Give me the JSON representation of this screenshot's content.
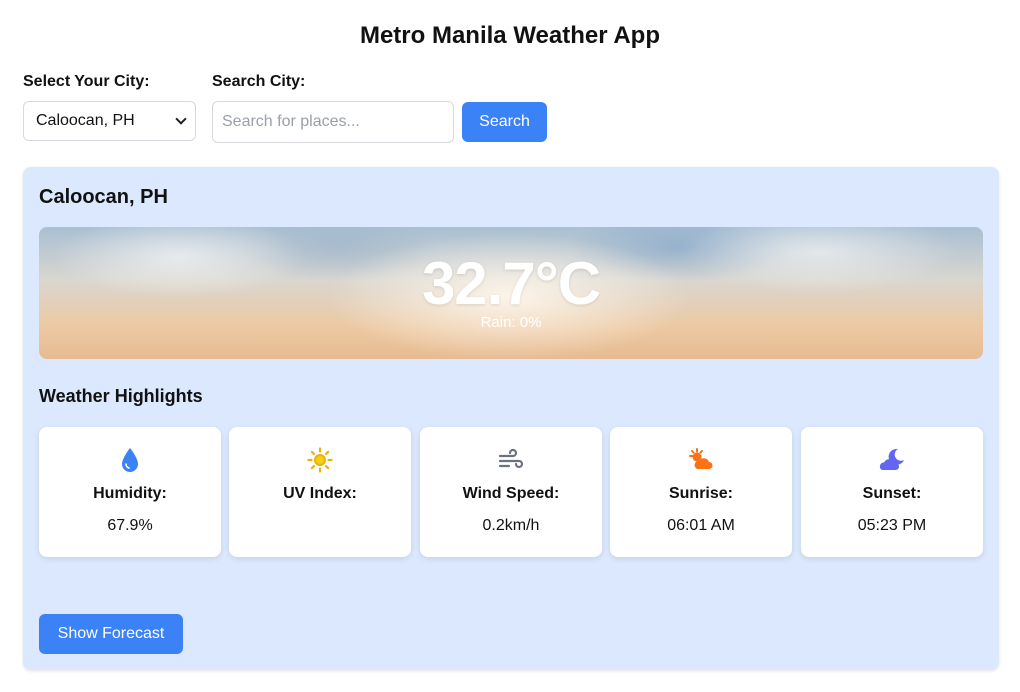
{
  "app": {
    "title": "Metro Manila Weather App"
  },
  "controls": {
    "city_label": "Select Your City:",
    "city_selected": "Caloocan, PH",
    "search_label": "Search City:",
    "search_placeholder": "Search for places...",
    "search_button": "Search"
  },
  "weather": {
    "city": "Caloocan, PH",
    "temperature": "32.7°C",
    "rain": "Rain: 0%"
  },
  "highlights": {
    "title": "Weather Highlights",
    "items": [
      {
        "icon": "droplet-icon",
        "label": "Humidity:",
        "value": "67.9%",
        "color": "#3b82f6"
      },
      {
        "icon": "sun-icon",
        "label": "UV Index:",
        "value": "",
        "color": "#eab308"
      },
      {
        "icon": "wind-icon",
        "label": "Wind Speed:",
        "value": "0.2km/h",
        "color": "#6b7280"
      },
      {
        "icon": "sunrise-icon",
        "label": "Sunrise:",
        "value": "06:01 AM",
        "color": "#f97316"
      },
      {
        "icon": "moon-cloud-icon",
        "label": "Sunset:",
        "value": "05:23 PM",
        "color": "#6366f1"
      }
    ]
  },
  "actions": {
    "forecast_button": "Show Forecast"
  },
  "colors": {
    "accent": "#3b82f6",
    "panel": "#dbe8fe"
  }
}
